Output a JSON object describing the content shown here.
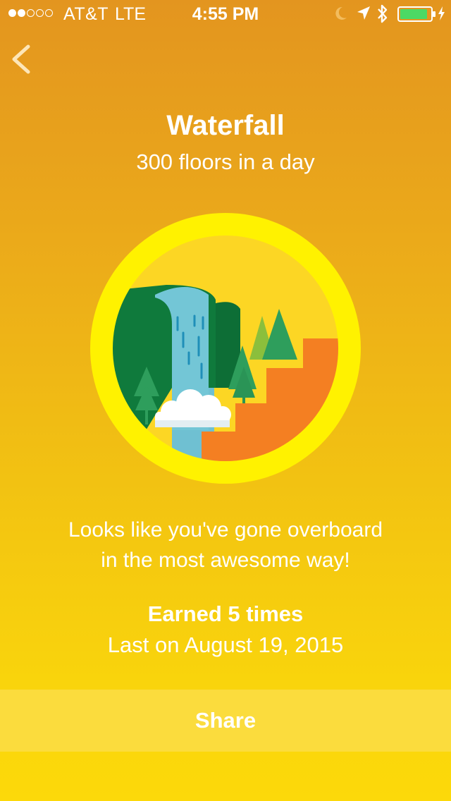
{
  "status_bar": {
    "carrier": "AT&T",
    "network": "LTE",
    "time": "4:55 PM",
    "signal_bars_filled": 2,
    "signal_bars_total": 5,
    "battery_level": 0.9,
    "battery_color": "#4cd964",
    "icons": [
      "moon-icon",
      "location-arrow-icon",
      "bluetooth-icon",
      "battery-icon",
      "charging-bolt-icon"
    ]
  },
  "nav": {
    "back_icon": "chevron-left-icon"
  },
  "badge": {
    "title": "Waterfall",
    "subtitle": "300 floors in a day",
    "ring_color": "#fff200",
    "illustration": "waterfall-badge-icon"
  },
  "message": {
    "line1": "Looks like you've gone overboard",
    "line2": "in the most awesome way!"
  },
  "stats": {
    "earned": "Earned 5 times",
    "last_on": "Last on August 19, 2015"
  },
  "actions": {
    "share_label": "Share"
  },
  "colors": {
    "background_top": "#e3951f",
    "background_bottom": "#fcd90a",
    "share_bar": "#fbdc3d"
  }
}
